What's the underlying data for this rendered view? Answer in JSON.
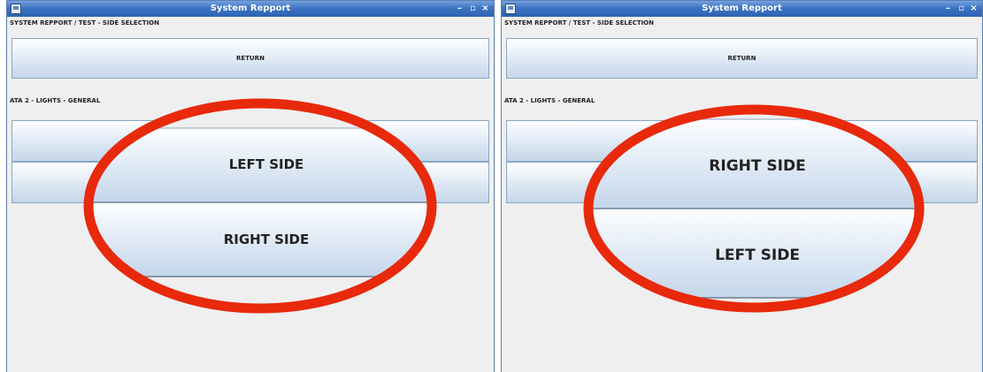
{
  "windows": [
    {
      "title": "System Repport",
      "breadcrumb": "SYSTEM REPPORT / TEST - SIDE SELECTION",
      "return_label": "RETURN",
      "section_label": "ATA 2 - LIGHTS - GENERAL",
      "top_option": "LEFT SIDE",
      "bottom_option": "RIGHT SIDE",
      "controls": {
        "minimize": "–",
        "maximize": "▫",
        "close": "×"
      }
    },
    {
      "title": "System Repport",
      "breadcrumb": "SYSTEM REPPORT / TEST - SIDE SELECTION",
      "return_label": "RETURN",
      "section_label": "ATA 2 - LIGHTS - GENERAL",
      "top_option": "RIGHT SIDE",
      "bottom_option": "LEFT SIDE",
      "controls": {
        "minimize": "–",
        "maximize": "▫",
        "close": "×"
      }
    }
  ],
  "colors": {
    "titlebar": "#3c73c2",
    "window_bg": "#efefef",
    "annotation": "#e8290b",
    "button_border": "#8aa6c6"
  },
  "icons": [
    "app-icon",
    "minimize-icon",
    "maximize-icon",
    "close-icon"
  ]
}
